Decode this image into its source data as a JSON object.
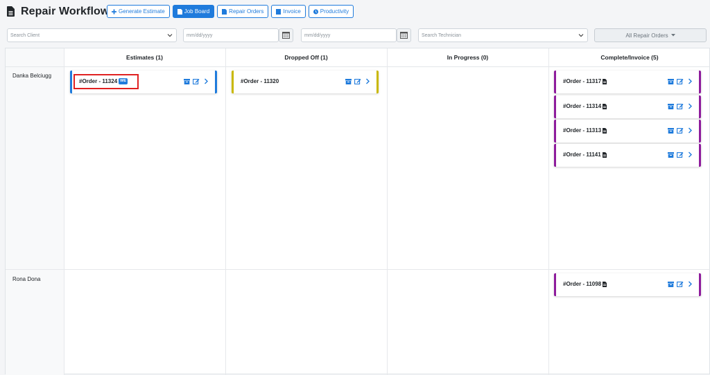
{
  "header": {
    "title": "Repair Workflow",
    "tabs": [
      {
        "label": "Generate Estimate",
        "icon": "plus-icon",
        "active": false
      },
      {
        "label": "Job Board",
        "icon": "document-icon",
        "active": true
      },
      {
        "label": "Repair Orders",
        "icon": "document-icon",
        "active": false
      },
      {
        "label": "Invoice",
        "icon": "invoice-icon",
        "active": false
      },
      {
        "label": "Productivity",
        "icon": "clock-icon",
        "active": false
      }
    ]
  },
  "filters": {
    "client_placeholder": "Search Client",
    "date_from_placeholder": "mm/dd/yyyy",
    "date_to_placeholder": "mm/dd/yyyy",
    "technician_placeholder": "Search Technician",
    "orders_filter": "All Repair Orders"
  },
  "columns": [
    {
      "label": "Estimates (1)"
    },
    {
      "label": "Dropped Off (1)"
    },
    {
      "label": "In Progress (0)"
    },
    {
      "label": "Complete/Invoice (5)"
    }
  ],
  "technicians": [
    {
      "name": "Danka Belciugg"
    },
    {
      "name": "Rona Dona"
    }
  ],
  "cards": {
    "estimate_1": {
      "order": "#Order - 11324",
      "badge": "WE"
    },
    "dropped_1": {
      "order": "#Order - 11320"
    },
    "complete_1": {
      "order": "#Order - 11317"
    },
    "complete_2": {
      "order": "#Order - 11314"
    },
    "complete_3": {
      "order": "#Order - 11313"
    },
    "complete_4": {
      "order": "#Order - 11141"
    },
    "complete_5": {
      "order": "#Order - 11098"
    }
  },
  "colors": {
    "accent": "#1f7bdc",
    "estimate": "#1f7bdc",
    "dropped_off": "#c9b800",
    "complete": "#8e1c9c",
    "highlight": "#e02020"
  }
}
